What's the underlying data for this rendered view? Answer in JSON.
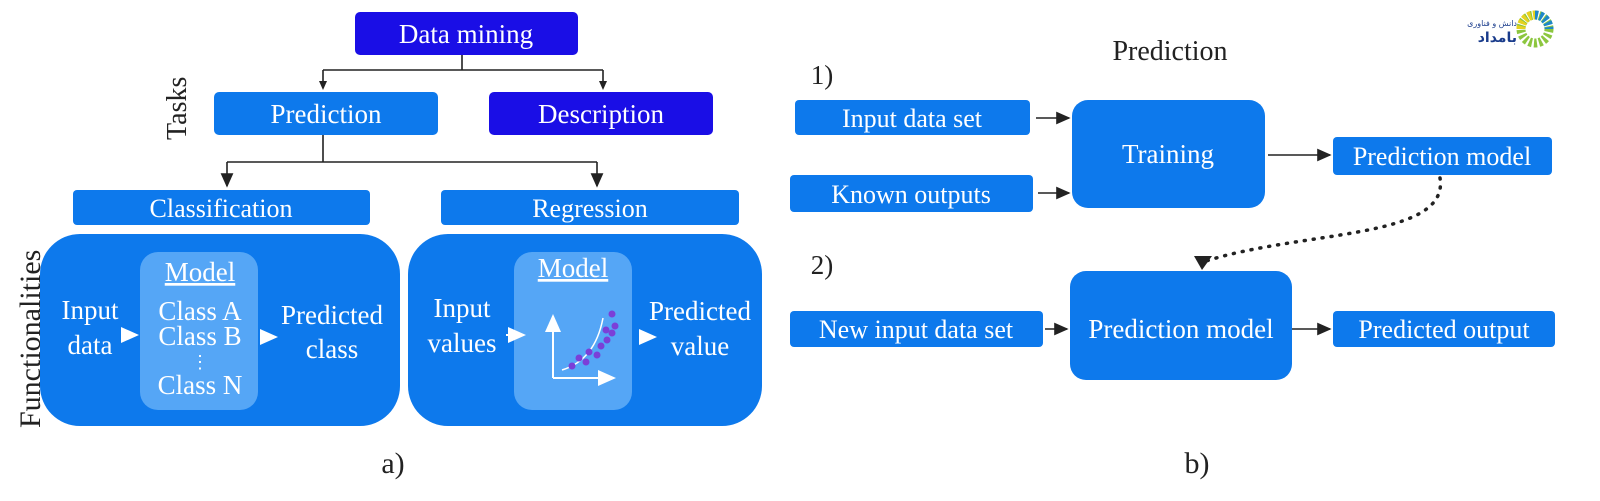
{
  "colors": {
    "primary": "#0d79ec",
    "dark": "#1a0ee6",
    "inner": "#55a6f6",
    "dots": "#7b3fd8"
  },
  "panel_a": {
    "root": "Data mining",
    "tasks_label": "Tasks",
    "functionalities_label": "Functionalities",
    "prediction": "Prediction",
    "description": "Description",
    "classification": "Classification",
    "regression": "Regression",
    "class_box": {
      "input_1": "Input",
      "input_2": "data",
      "model": "Model",
      "classes": [
        "Class A",
        "Class B",
        "⋮",
        "Class N"
      ],
      "output_1": "Predicted",
      "output_2": "class"
    },
    "reg_box": {
      "input_1": "Input",
      "input_2": "values",
      "model": "Model",
      "output_1": "Predicted",
      "output_2": "value"
    },
    "caption": "a)"
  },
  "panel_b": {
    "title": "Prediction",
    "step1": "1)",
    "input_data_set": "Input data set",
    "known_outputs": "Known outputs",
    "training": "Training",
    "prediction_model_top": "Prediction model",
    "step2": "2)",
    "new_input_data_set": "New input data set",
    "prediction_model": "Prediction model",
    "predicted_output": "Predicted output",
    "caption": "b)"
  },
  "logo": {
    "text_line1": "دانش و فناوری",
    "text_line2": "بامداد"
  }
}
